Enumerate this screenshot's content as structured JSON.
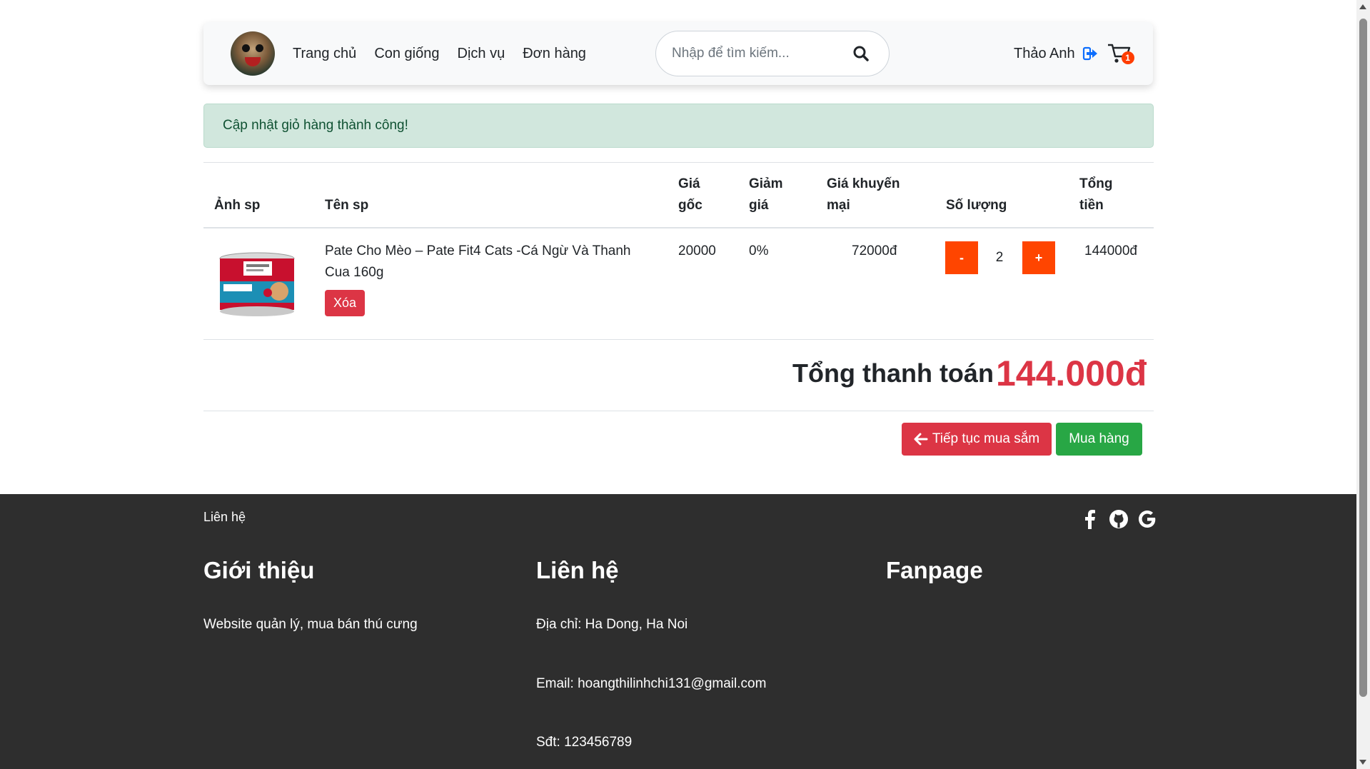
{
  "navbar": {
    "links": [
      "Trang chủ",
      "Con giống",
      "Dịch vụ",
      "Đơn hàng"
    ],
    "search_placeholder": "Nhập để tìm kiếm...",
    "user_name": "Thảo Anh",
    "cart_count": "1"
  },
  "alert": {
    "message": "Cập nhật giỏ hàng thành công!"
  },
  "table": {
    "headers": {
      "image": "Ảnh sp",
      "name": "Tên sp",
      "original_price_1": "Giá",
      "original_price_2": "gốc",
      "discount_1": "Giảm",
      "discount_2": "giá",
      "promo_price_1": "Giá khuyến",
      "promo_price_2": "mại",
      "quantity": "Số lượng",
      "total_1": "Tổng",
      "total_2": "tiền"
    },
    "rows": [
      {
        "name_1": "Pate Cho Mèo – Pate Fit4 Cats -Cá Ngừ Và Thanh",
        "name_2": "Cua 160g",
        "delete_label": "Xóa",
        "original_price": "20000",
        "discount": "0%",
        "promo_price": "72000đ",
        "minus_label": "-",
        "quantity": "2",
        "plus_label": "+",
        "total": "144000đ"
      }
    ]
  },
  "summary": {
    "total_label": "Tổng thanh toán",
    "total_value": "144.000đ",
    "continue_label": "Tiếp tục mua sắm",
    "buy_label": "Mua hàng"
  },
  "footer": {
    "contact_link": "Liên hệ",
    "socials": [
      "facebook-icon",
      "github-icon",
      "google-icon"
    ],
    "about_title": "Giới thiệu",
    "about_text": "Website quản lý, mua bán thú cưng",
    "contact_title": "Liên hệ",
    "address": "Địa chỉ: Ha Dong, Ha Noi",
    "email": "Email: hoangthilinhchi131@gmail.com",
    "phone": "Sđt: 123456789",
    "fanpage_title": "Fanpage"
  },
  "colors": {
    "accent_orange": "#ff4500",
    "danger": "#dc3545",
    "success": "#28a745",
    "alert_bg": "#d1e7dd",
    "footer_bg": "#2e2e2e"
  }
}
